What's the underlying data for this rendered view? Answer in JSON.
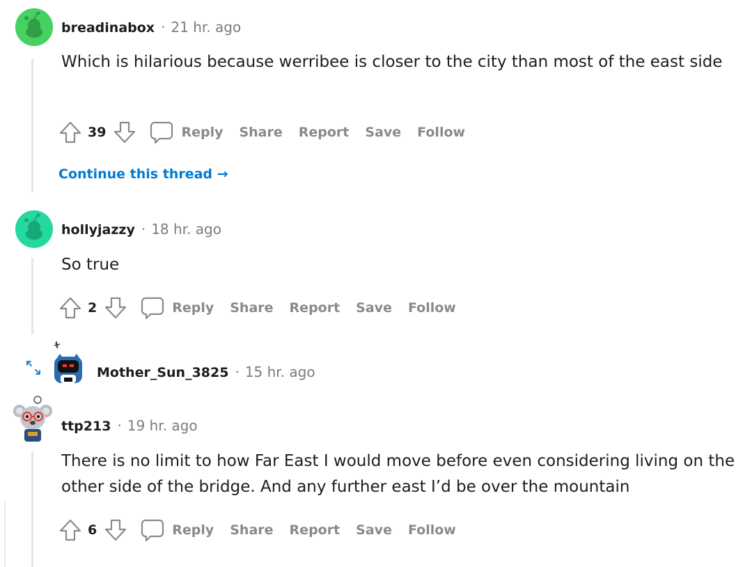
{
  "colors": {
    "accent_link": "#0079d3",
    "meta_gray": "#7c7c7c",
    "action_gray": "#878a8c",
    "thread_line": "#e5e5e5",
    "snoo_green": "#46d160",
    "snoo_teal": "#24d9a0"
  },
  "comments": [
    {
      "username": "breadinabox",
      "separator": "·",
      "time": "21 hr. ago",
      "body": "Which is hilarious because werribee is closer to the city than most of the east side",
      "score": "39",
      "actions": {
        "reply": "Reply",
        "share": "Share",
        "report": "Report",
        "save": "Save",
        "follow": "Follow"
      },
      "continue_thread": "Continue this thread →"
    },
    {
      "username": "hollyjazzy",
      "separator": "·",
      "time": "18 hr. ago",
      "body": "So true",
      "score": "2",
      "actions": {
        "reply": "Reply",
        "share": "Share",
        "report": "Report",
        "save": "Save",
        "follow": "Follow"
      }
    },
    {
      "username": "Mother_Sun_3825",
      "separator": "·",
      "time": "15 hr. ago",
      "collapsed": true,
      "expand_icon": "expand-arrows-icon"
    },
    {
      "username": "ttp213",
      "separator": "·",
      "time": "19 hr. ago",
      "body": "There is no limit to how Far East I would move before even considering living on the other side of the bridge. And any further east I’d be over the mountain",
      "score": "6",
      "actions": {
        "reply": "Reply",
        "share": "Share",
        "report": "Report",
        "save": "Save",
        "follow": "Follow"
      }
    }
  ]
}
